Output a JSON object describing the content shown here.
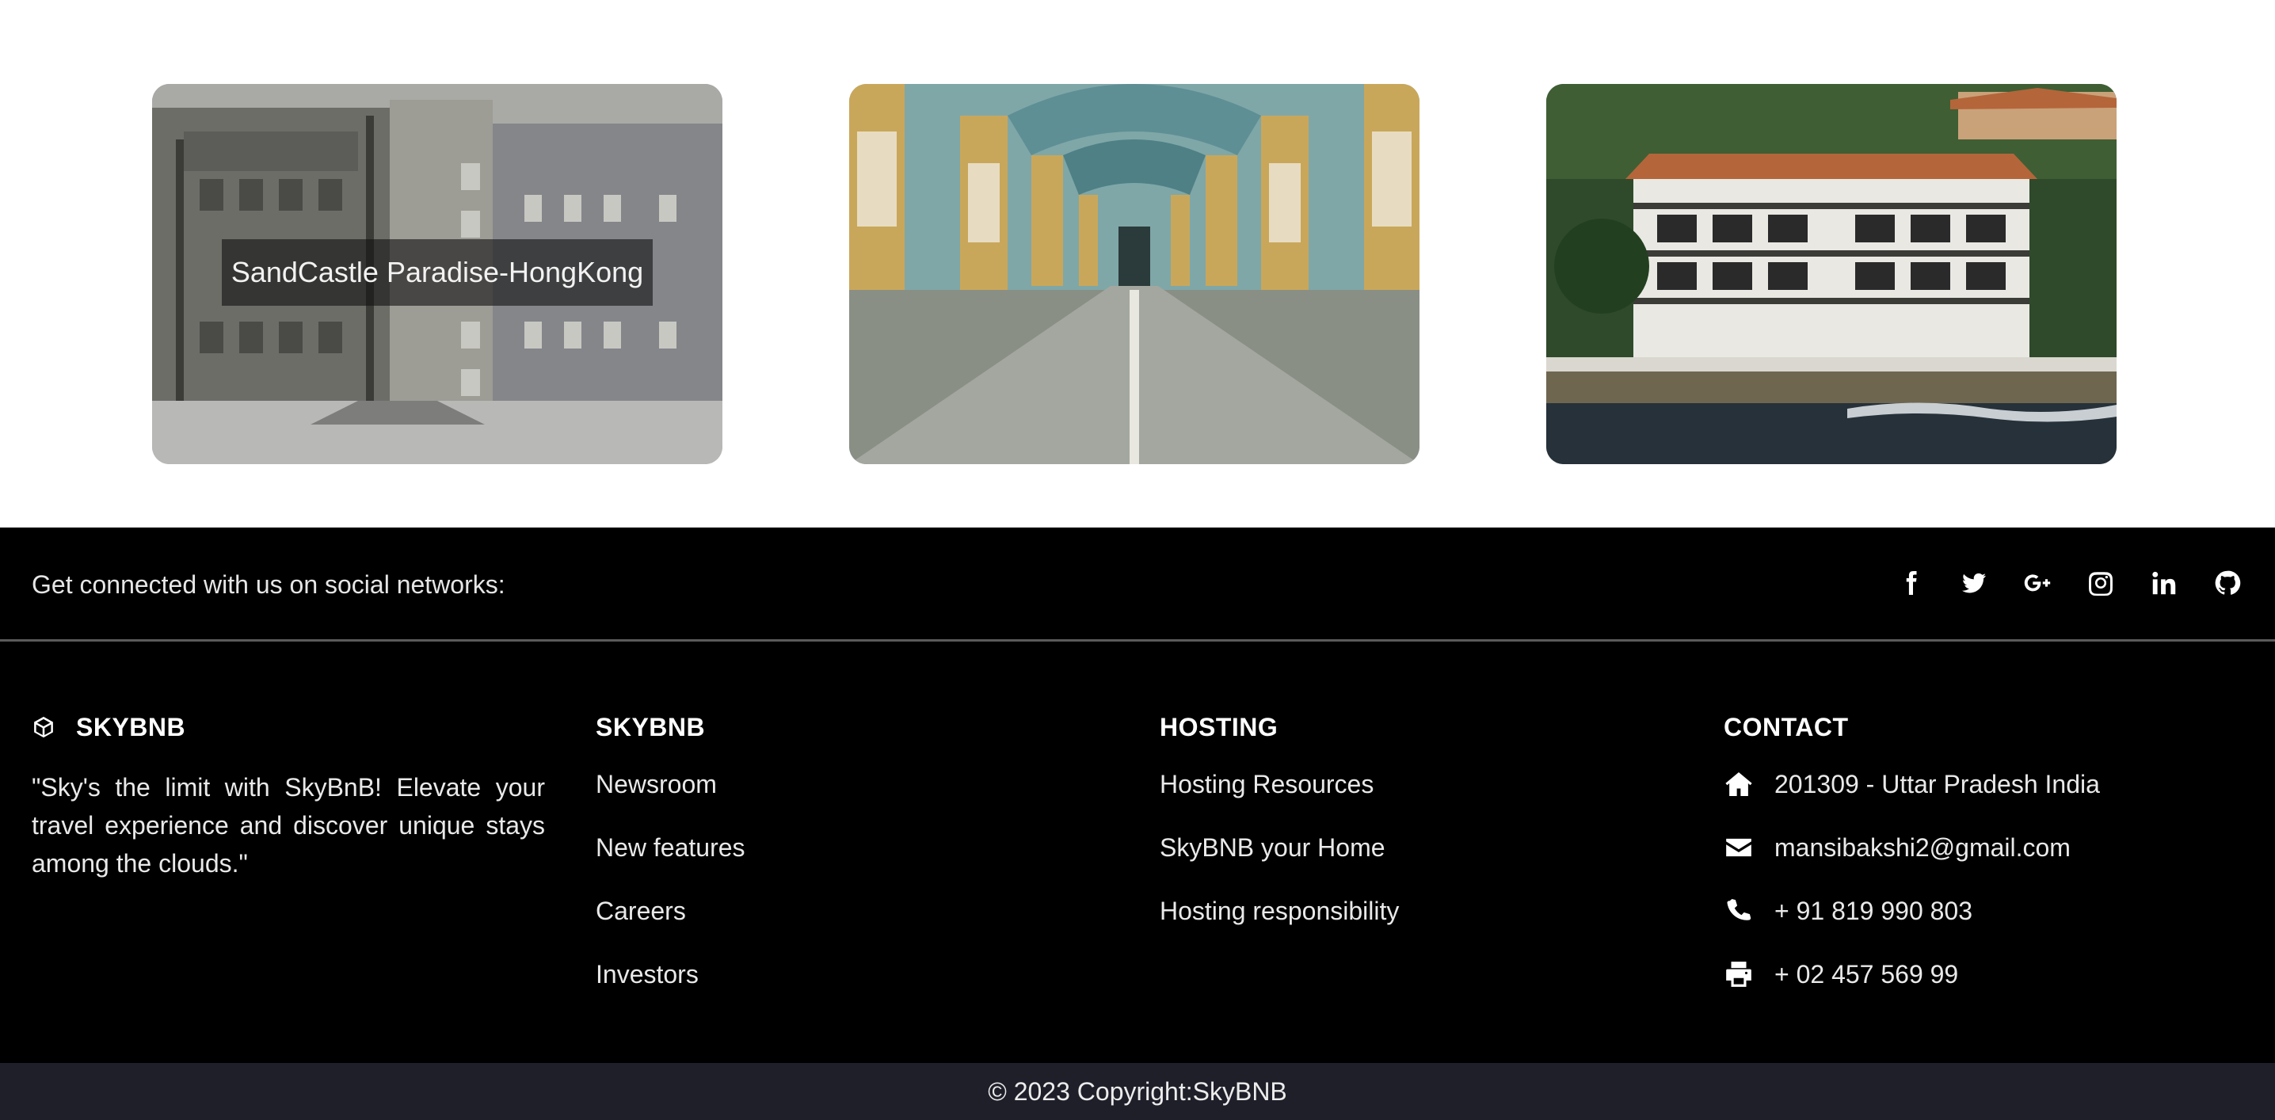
{
  "gallery": {
    "cards": [
      {
        "caption": "SandCastle Paradise-HongKong"
      },
      {
        "caption": ""
      },
      {
        "caption": ""
      }
    ]
  },
  "social": {
    "text": "Get connected with us on social networks:",
    "icons": [
      "facebook-icon",
      "twitter-icon",
      "google-plus-icon",
      "instagram-icon",
      "linkedin-icon",
      "github-icon"
    ]
  },
  "footer": {
    "brand": {
      "title": "SKYBNB",
      "about": "\"Sky's the limit with SkyBnB! Elevate your travel experience and discover unique stays among the clouds.\""
    },
    "skybnb": {
      "title": "SKYBNB",
      "links": [
        "Newsroom",
        "New features",
        "Careers",
        "Investors"
      ]
    },
    "hosting": {
      "title": "HOSTING",
      "links": [
        "Hosting Resources",
        "SkyBNB your Home",
        "Hosting responsibility"
      ]
    },
    "contact": {
      "title": "CONTACT",
      "address": "201309 - Uttar Pradesh India",
      "email": "mansibakshi2@gmail.com",
      "phone": "+ 91 819 990 803",
      "fax": "+ 02 457 569 99"
    }
  },
  "copyright": "© 2023 Copyright:SkyBNB",
  "colors": {
    "footer_bg": "#000000",
    "copyright_bg": "#1f1f2a",
    "text": "#ffffff"
  }
}
